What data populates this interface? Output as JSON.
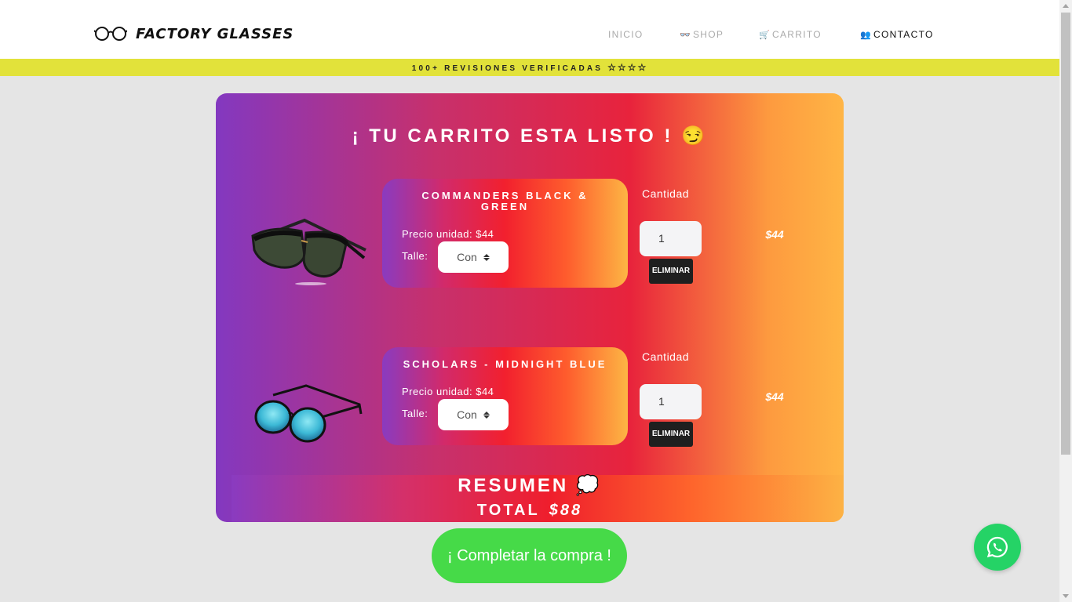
{
  "brand": {
    "name": "FACTORY GLASSES"
  },
  "nav": [
    {
      "label": "INICIO",
      "icon": ""
    },
    {
      "label": "SHOP",
      "icon": "glasses-icon"
    },
    {
      "label": "CARRITO",
      "icon": "cart-icon"
    },
    {
      "label": "CONTACTO",
      "icon": "contact-icon"
    }
  ],
  "banner": {
    "text": "100+ REVISIONES VERIFICADAS",
    "stars": "☆☆☆☆"
  },
  "cart": {
    "title": "¡ TU CARRITO ESTA LISTO ! 😏",
    "items": [
      {
        "name": "COMMANDERS BLACK & GREEN",
        "price_text": "Precio unidad: $44",
        "talle_label": "Talle:",
        "talle_value": "Con",
        "qty_label": "Cantidad",
        "qty": "1",
        "delete_label": "ELIMINAR",
        "line_total": "$44"
      },
      {
        "name": "SCHOLARS - MIDNIGHT BLUE",
        "price_text": "Precio unidad: $44",
        "talle_label": "Talle:",
        "talle_value": "Con",
        "qty_label": "Cantidad",
        "qty": "1",
        "delete_label": "ELIMINAR",
        "line_total": "$44"
      }
    ]
  },
  "summary": {
    "title": "RESUMEN 💭",
    "total_label": "TOTAL",
    "total_value": "$88"
  },
  "checkout": {
    "label": "¡ Completar la compra !"
  },
  "colors": {
    "banner": "#e2e23a",
    "checkout": "#46da48",
    "whatsapp": "#25d366",
    "delete": "#1f1f1f"
  }
}
